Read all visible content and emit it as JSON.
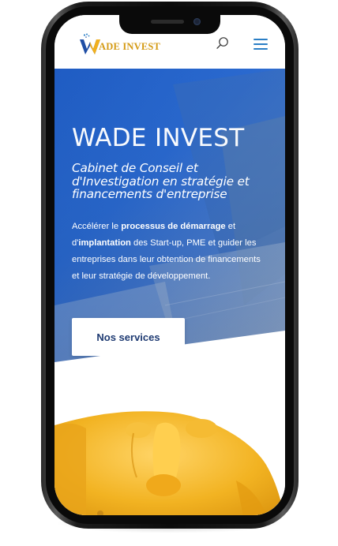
{
  "header": {
    "logo_text": "ADE INVEST",
    "logo_letter": "W"
  },
  "hero": {
    "title": "WADE INVEST",
    "subtitle": "Cabinet de Conseil et d'Investigation en stratégie et financements d'entreprise",
    "desc_1": "Accélérer le ",
    "desc_2": "processus de démarrage",
    "desc_3": " et d'",
    "desc_4": "implantation",
    "desc_5": " des Start-up, PME et guider les entreprises dans leur obtention de financements et leur stratégie de développement.",
    "cta_label": "Nos services"
  },
  "colors": {
    "accent_blue": "#2a7ec5",
    "logo_gold": "#d49a13",
    "hero_blue": "#1f5cc3",
    "cta_text": "#1e3a72",
    "gold_image": "#f0b528"
  },
  "icons": {
    "search": "search-icon",
    "menu": "hamburger-menu-icon"
  }
}
